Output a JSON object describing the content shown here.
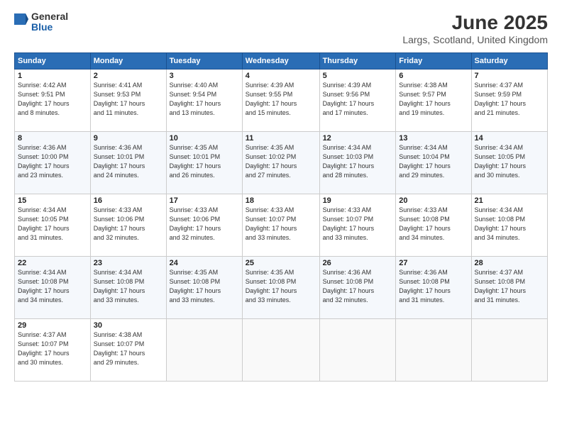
{
  "logo": {
    "general": "General",
    "blue": "Blue"
  },
  "title": "June 2025",
  "location": "Largs, Scotland, United Kingdom",
  "header_days": [
    "Sunday",
    "Monday",
    "Tuesday",
    "Wednesday",
    "Thursday",
    "Friday",
    "Saturday"
  ],
  "weeks": [
    [
      {
        "day": "1",
        "info": "Sunrise: 4:42 AM\nSunset: 9:51 PM\nDaylight: 17 hours\nand 8 minutes."
      },
      {
        "day": "2",
        "info": "Sunrise: 4:41 AM\nSunset: 9:53 PM\nDaylight: 17 hours\nand 11 minutes."
      },
      {
        "day": "3",
        "info": "Sunrise: 4:40 AM\nSunset: 9:54 PM\nDaylight: 17 hours\nand 13 minutes."
      },
      {
        "day": "4",
        "info": "Sunrise: 4:39 AM\nSunset: 9:55 PM\nDaylight: 17 hours\nand 15 minutes."
      },
      {
        "day": "5",
        "info": "Sunrise: 4:39 AM\nSunset: 9:56 PM\nDaylight: 17 hours\nand 17 minutes."
      },
      {
        "day": "6",
        "info": "Sunrise: 4:38 AM\nSunset: 9:57 PM\nDaylight: 17 hours\nand 19 minutes."
      },
      {
        "day": "7",
        "info": "Sunrise: 4:37 AM\nSunset: 9:59 PM\nDaylight: 17 hours\nand 21 minutes."
      }
    ],
    [
      {
        "day": "8",
        "info": "Sunrise: 4:36 AM\nSunset: 10:00 PM\nDaylight: 17 hours\nand 23 minutes."
      },
      {
        "day": "9",
        "info": "Sunrise: 4:36 AM\nSunset: 10:01 PM\nDaylight: 17 hours\nand 24 minutes."
      },
      {
        "day": "10",
        "info": "Sunrise: 4:35 AM\nSunset: 10:01 PM\nDaylight: 17 hours\nand 26 minutes."
      },
      {
        "day": "11",
        "info": "Sunrise: 4:35 AM\nSunset: 10:02 PM\nDaylight: 17 hours\nand 27 minutes."
      },
      {
        "day": "12",
        "info": "Sunrise: 4:34 AM\nSunset: 10:03 PM\nDaylight: 17 hours\nand 28 minutes."
      },
      {
        "day": "13",
        "info": "Sunrise: 4:34 AM\nSunset: 10:04 PM\nDaylight: 17 hours\nand 29 minutes."
      },
      {
        "day": "14",
        "info": "Sunrise: 4:34 AM\nSunset: 10:05 PM\nDaylight: 17 hours\nand 30 minutes."
      }
    ],
    [
      {
        "day": "15",
        "info": "Sunrise: 4:34 AM\nSunset: 10:05 PM\nDaylight: 17 hours\nand 31 minutes."
      },
      {
        "day": "16",
        "info": "Sunrise: 4:33 AM\nSunset: 10:06 PM\nDaylight: 17 hours\nand 32 minutes."
      },
      {
        "day": "17",
        "info": "Sunrise: 4:33 AM\nSunset: 10:06 PM\nDaylight: 17 hours\nand 32 minutes."
      },
      {
        "day": "18",
        "info": "Sunrise: 4:33 AM\nSunset: 10:07 PM\nDaylight: 17 hours\nand 33 minutes."
      },
      {
        "day": "19",
        "info": "Sunrise: 4:33 AM\nSunset: 10:07 PM\nDaylight: 17 hours\nand 33 minutes."
      },
      {
        "day": "20",
        "info": "Sunrise: 4:33 AM\nSunset: 10:08 PM\nDaylight: 17 hours\nand 34 minutes."
      },
      {
        "day": "21",
        "info": "Sunrise: 4:34 AM\nSunset: 10:08 PM\nDaylight: 17 hours\nand 34 minutes."
      }
    ],
    [
      {
        "day": "22",
        "info": "Sunrise: 4:34 AM\nSunset: 10:08 PM\nDaylight: 17 hours\nand 34 minutes."
      },
      {
        "day": "23",
        "info": "Sunrise: 4:34 AM\nSunset: 10:08 PM\nDaylight: 17 hours\nand 33 minutes."
      },
      {
        "day": "24",
        "info": "Sunrise: 4:35 AM\nSunset: 10:08 PM\nDaylight: 17 hours\nand 33 minutes."
      },
      {
        "day": "25",
        "info": "Sunrise: 4:35 AM\nSunset: 10:08 PM\nDaylight: 17 hours\nand 33 minutes."
      },
      {
        "day": "26",
        "info": "Sunrise: 4:36 AM\nSunset: 10:08 PM\nDaylight: 17 hours\nand 32 minutes."
      },
      {
        "day": "27",
        "info": "Sunrise: 4:36 AM\nSunset: 10:08 PM\nDaylight: 17 hours\nand 31 minutes."
      },
      {
        "day": "28",
        "info": "Sunrise: 4:37 AM\nSunset: 10:08 PM\nDaylight: 17 hours\nand 31 minutes."
      }
    ],
    [
      {
        "day": "29",
        "info": "Sunrise: 4:37 AM\nSunset: 10:07 PM\nDaylight: 17 hours\nand 30 minutes."
      },
      {
        "day": "30",
        "info": "Sunrise: 4:38 AM\nSunset: 10:07 PM\nDaylight: 17 hours\nand 29 minutes."
      },
      null,
      null,
      null,
      null,
      null
    ]
  ]
}
